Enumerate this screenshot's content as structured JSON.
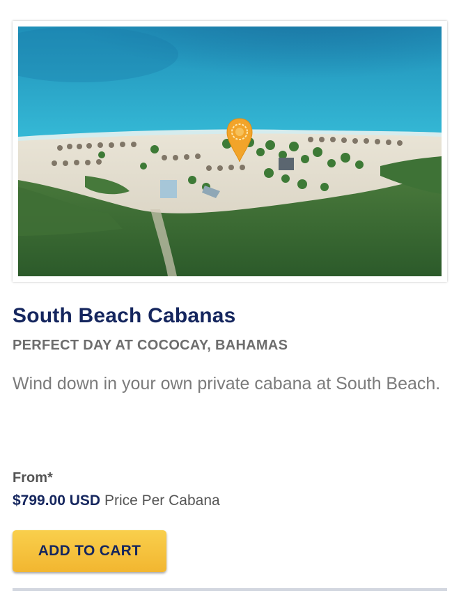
{
  "card": {
    "image_alt": "Aerial view of South Beach with a location pin",
    "title": "South Beach Cabanas",
    "subtitle": "PERFECT DAY AT COCOCAY, BAHAMAS",
    "description": "Wind down in your own private cabana at South Beach.",
    "price": {
      "from_label": "From*",
      "amount": "$799.00 USD",
      "unit": "Price Per Cabana"
    },
    "add_to_cart_label": "ADD TO CART"
  },
  "colors": {
    "title_navy": "#15265e",
    "button_yellow": "#f5c23d",
    "subtitle_gray": "#6d6d6d",
    "pin_orange": "#f2a42a"
  },
  "icons": {
    "pin": "location-pin-icon"
  }
}
